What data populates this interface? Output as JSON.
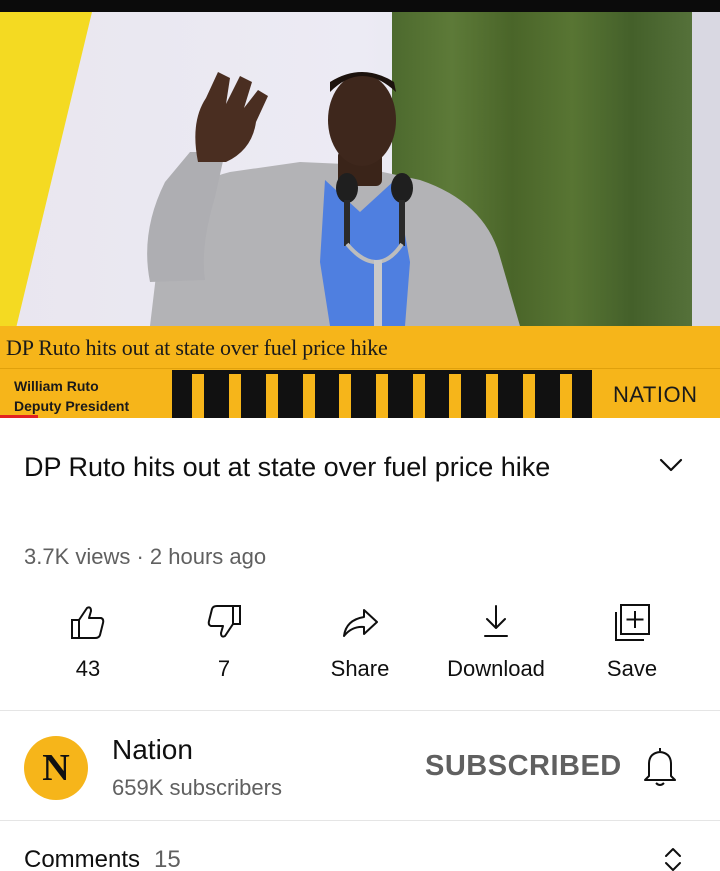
{
  "player": {
    "headline": "DP Ruto hits out at state over fuel price hike",
    "speaker_name": "William Ruto",
    "speaker_role": "Deputy President",
    "brand": "NATION",
    "accent_color": "#f6b51a"
  },
  "video": {
    "title": "DP Ruto hits out at state over fuel price hike",
    "meta": "3.7K views · 2 hours ago",
    "expand_icon": "chevron-down-icon"
  },
  "actions": {
    "like": {
      "label": "43",
      "icon": "thumbs-up-icon"
    },
    "dislike": {
      "label": "7",
      "icon": "thumbs-down-icon"
    },
    "share": {
      "label": "Share",
      "icon": "share-icon"
    },
    "download": {
      "label": "Download",
      "icon": "download-icon"
    },
    "save": {
      "label": "Save",
      "icon": "playlist-add-icon"
    }
  },
  "channel": {
    "avatar_letter": "N",
    "name": "Nation",
    "subscribers": "659K subscribers",
    "subscribe_state": "SUBSCRIBED",
    "bell_icon": "bell-icon"
  },
  "comments": {
    "label": "Comments",
    "count": "15",
    "toggle_icon": "unfold-icon"
  }
}
